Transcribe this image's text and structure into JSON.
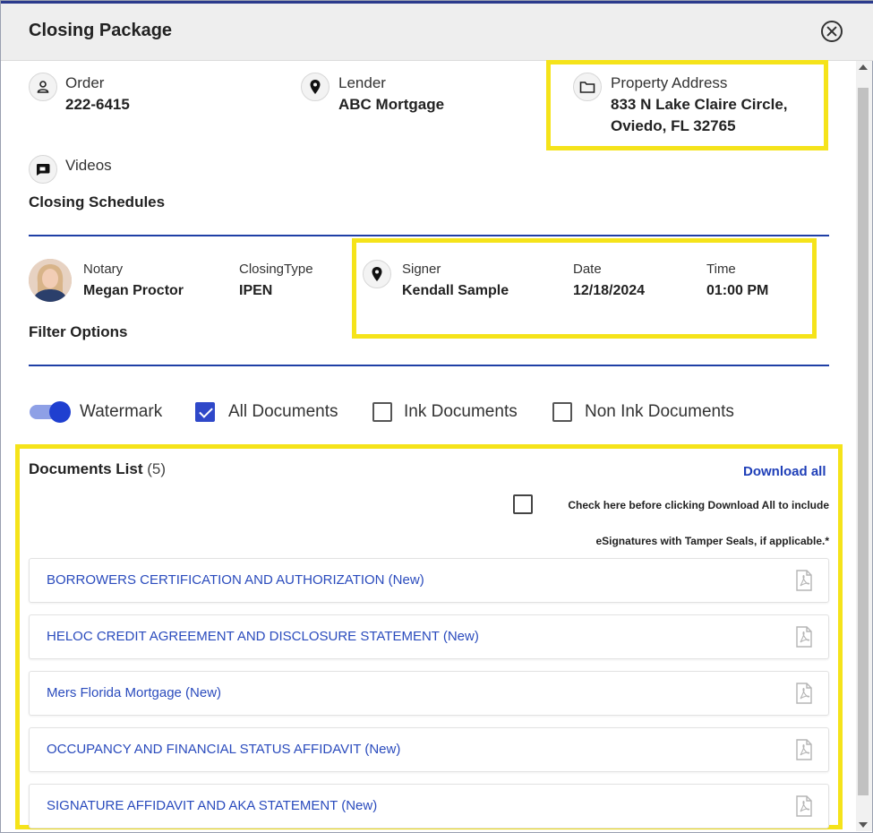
{
  "dialog": {
    "title": "Closing Package"
  },
  "info": {
    "order": {
      "label": "Order",
      "value": "222-6415"
    },
    "lender": {
      "label": "Lender",
      "value": "ABC Mortgage"
    },
    "property": {
      "label": "Property Address",
      "line1": "833 N Lake Claire Circle,",
      "line2": "Oviedo, FL 32765"
    },
    "videos": {
      "label": "Videos"
    }
  },
  "closing_schedules": {
    "title": "Closing Schedules",
    "notary": {
      "label": "Notary",
      "value": "Megan Proctor"
    },
    "closing_type": {
      "label": "ClosingType",
      "value": "IPEN"
    },
    "signer": {
      "label": "Signer",
      "value": "Kendall Sample"
    },
    "date": {
      "label": "Date",
      "value": "12/18/2024"
    },
    "time": {
      "label": "Time",
      "value": "01:00 PM"
    }
  },
  "filter_options": {
    "title": "Filter Options",
    "watermark": {
      "label": "Watermark",
      "on": true
    },
    "all_documents": {
      "label": "All Documents",
      "checked": true
    },
    "ink_documents": {
      "label": "Ink Documents",
      "checked": false
    },
    "non_ink_documents": {
      "label": "Non Ink Documents",
      "checked": false
    }
  },
  "documents": {
    "title": "Documents List",
    "count": "(5)",
    "download_all": "Download all",
    "tamper_note_line1": "Check here before clicking Download All to include",
    "tamper_note_line2": "eSignatures with Tamper Seals, if applicable.*",
    "items": [
      {
        "name": "BORROWERS CERTIFICATION AND AUTHORIZATION (New)"
      },
      {
        "name": "HELOC CREDIT AGREEMENT AND DISCLOSURE STATEMENT (New)"
      },
      {
        "name": "Mers Florida Mortgage (New)"
      },
      {
        "name": "OCCUPANCY AND FINANCIAL STATUS AFFIDAVIT (New)"
      },
      {
        "name": "SIGNATURE AFFIDAVIT AND AKA STATEMENT (New)"
      }
    ]
  },
  "colors": {
    "accent": "#1f3fa6",
    "highlight": "#f5e31a",
    "link": "#2a4bbd"
  }
}
